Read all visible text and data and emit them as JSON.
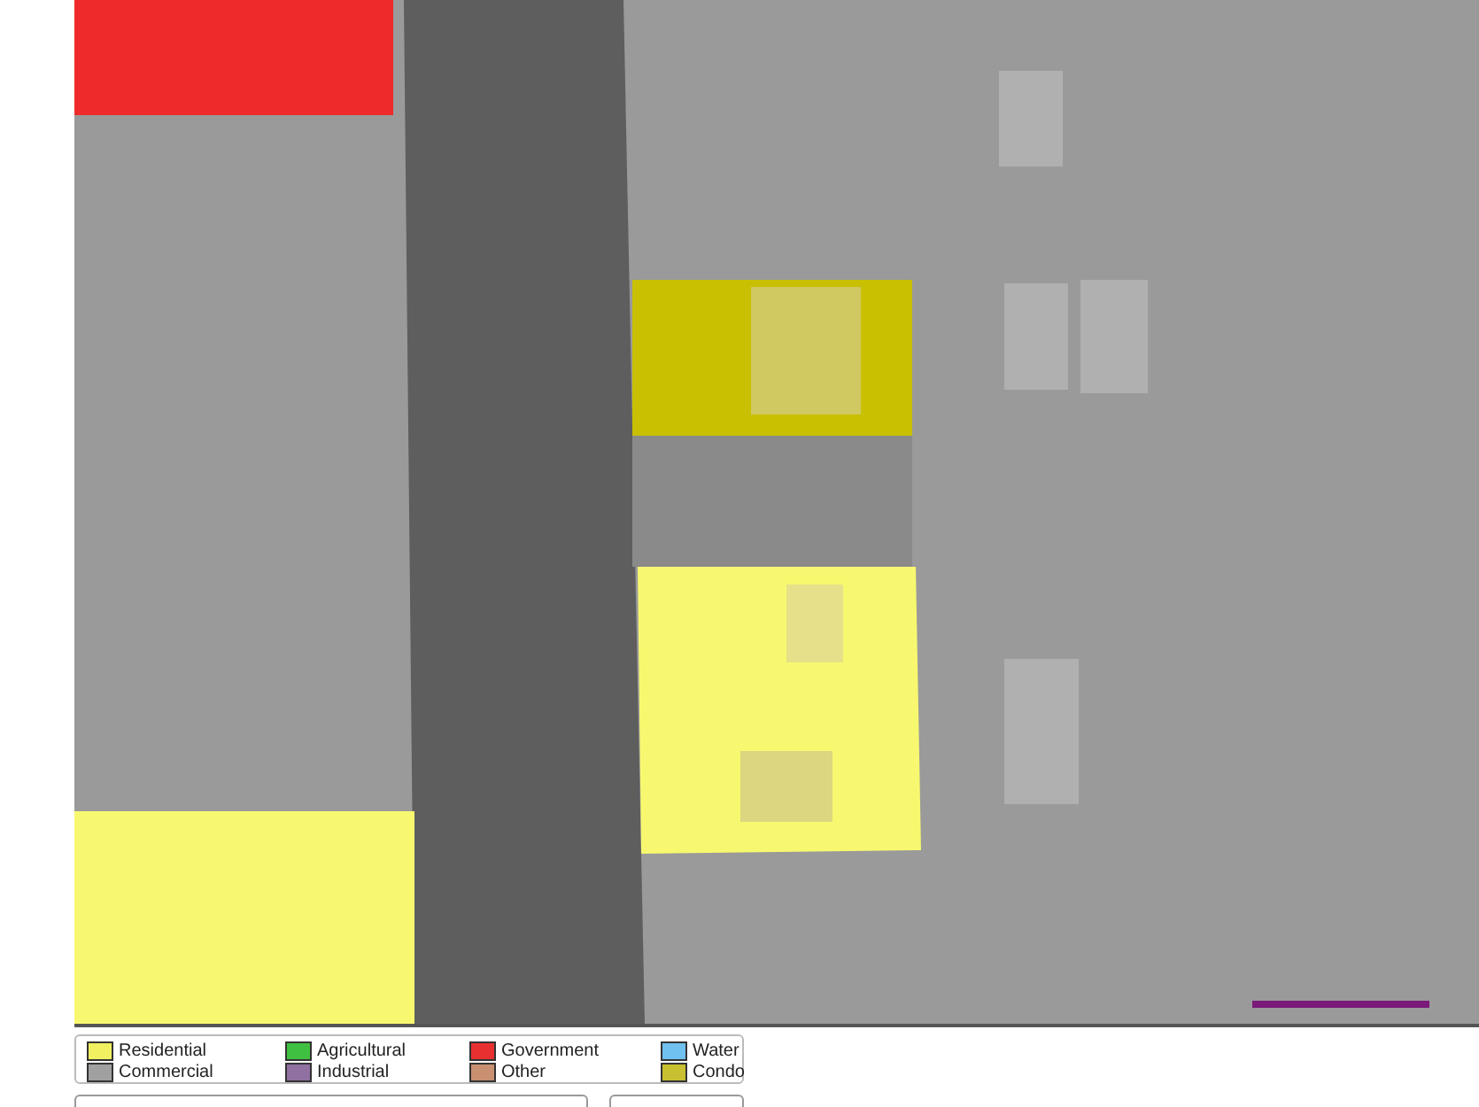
{
  "legend": [
    {
      "label": "Residential",
      "color": "#f0f060"
    },
    {
      "label": "Agricultural",
      "color": "#40c040"
    },
    {
      "label": "Government",
      "color": "#e83030"
    },
    {
      "label": "Water",
      "color": "#70c0f0"
    },
    {
      "label": "Commercial",
      "color": "#a0a0a0"
    },
    {
      "label": "Industrial",
      "color": "#9070a0"
    },
    {
      "label": "Other",
      "color": "#c89070"
    },
    {
      "label": "Condo",
      "color": "#c8c030"
    }
  ]
}
